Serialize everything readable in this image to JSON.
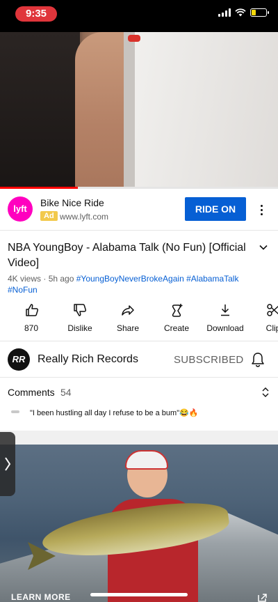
{
  "status_bar": {
    "time": "9:35",
    "battery_level": 0.3
  },
  "video": {
    "progress": 0.28
  },
  "ad": {
    "logo_text": "lyft",
    "title": "Bike Nice Ride",
    "badge": "Ad",
    "url": "www.lyft.com",
    "cta": "RIDE ON"
  },
  "video_info": {
    "title": "NBA YoungBoy - Alabama Talk (No Fun) [Official Video]",
    "views": "4K views",
    "separator": " · ",
    "age": "5h ago",
    "hashtags": [
      "#YoungBoyNeverBrokeAgain",
      "#AlabamaTalk",
      "#NoFun"
    ]
  },
  "actions": [
    {
      "label": "870",
      "icon": "thumbs-up-icon"
    },
    {
      "label": "Dislike",
      "icon": "thumbs-down-icon"
    },
    {
      "label": "Share",
      "icon": "share-icon"
    },
    {
      "label": "Create",
      "icon": "create-icon"
    },
    {
      "label": "Download",
      "icon": "download-icon"
    },
    {
      "label": "Clip",
      "icon": "scissors-icon"
    }
  ],
  "channel": {
    "avatar_text": "RR",
    "name": "Really Rich Records",
    "subscribe_state": "SUBSCRIBED"
  },
  "comments": {
    "heading": "Comments",
    "count": "54",
    "top_comment": "\"I been hustling all day I refuse to be a bum\"😂🔥"
  },
  "promo": {
    "cta": "LEARN MORE"
  },
  "colors": {
    "accent_blue": "#065fd4",
    "progress_red": "#ff0000",
    "lyft_pink": "#ff00bf",
    "time_pill": "#e0353b"
  }
}
